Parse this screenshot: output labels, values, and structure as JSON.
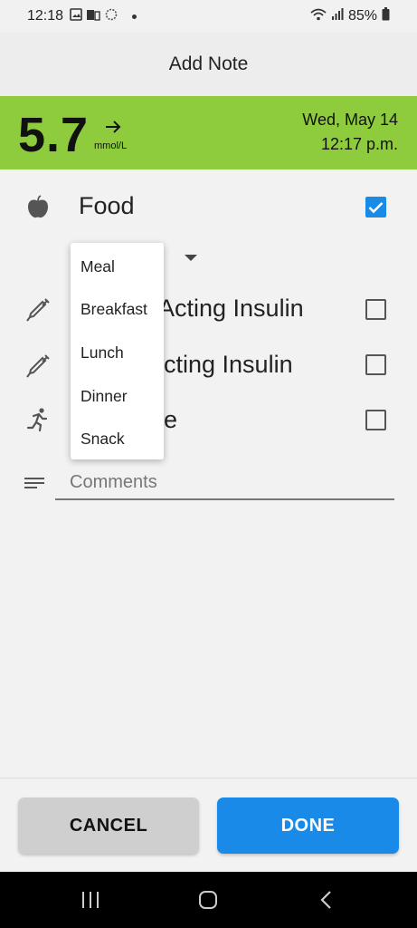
{
  "status_bar": {
    "time": "12:18",
    "battery": "85%"
  },
  "header": {
    "title": "Add Note"
  },
  "glucose": {
    "value": "5.7",
    "unit": "mmol/L",
    "date": "Wed, May 14",
    "time": "12:17 p.m.",
    "color": "#8fcc3d",
    "trend": "arrow-right-icon"
  },
  "rows": {
    "food": {
      "label": "Food",
      "checked": true
    },
    "rapid_insulin": {
      "label_visible": "Acting Insulin",
      "checked": false
    },
    "long_insulin": {
      "label_visible": "cting Insulin",
      "checked": false
    },
    "exercise": {
      "label_visible": "e",
      "checked": false
    }
  },
  "comments": {
    "placeholder": "Comments"
  },
  "popup_menu": {
    "items": [
      "Meal",
      "Breakfast",
      "Lunch",
      "Dinner",
      "Snack"
    ]
  },
  "buttons": {
    "cancel": "CANCEL",
    "done": "DONE"
  },
  "colors": {
    "accent": "#1a8ae8",
    "glucose_banner": "#8fcc3d"
  }
}
